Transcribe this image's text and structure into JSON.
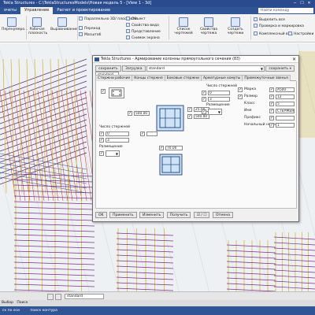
{
  "window": {
    "title": "Tekla Structures - C:\\TeklaStructuresModels\\Новая модель 5 - [View 1 - 3d]"
  },
  "ribbon": {
    "tabs": [
      "очеты",
      "Управление",
      "Расчет и проектирование"
    ],
    "active_tab": 1,
    "search_placeholder": "Найти команду",
    "buttons": {
      "renumber": "Перенумеро...",
      "work_area": "Рабочая плоскость",
      "align": "Выравнивание",
      "parallel": "Параллельно 3D/ плоскости",
      "move": "Переход",
      "scale": "Масштаб",
      "object": "Объект",
      "view_props": "Свойства вида",
      "presentation": "Представление",
      "screen_snapshot": "Снимок экрана",
      "drawings_list": "Список чертежей",
      "drawing_props": "Свойства чертежа",
      "create_drawings": "Создать чертежи",
      "select_all": "Выделить все",
      "check_and_mark": "Проверка и маркировка",
      "complex_view": "Комплексный вид",
      "settings": "Настройки"
    }
  },
  "dialog": {
    "title": "Tekla Structures - Армирование колонны прямоугольного сечения (83)",
    "save_label": "сохранить",
    "load_label": "Загрузка",
    "preset_value": "standard",
    "save_as_label": "сохранить к",
    "save_as_value": "standard",
    "tabs": [
      "Стержни рабочие",
      "Концы стержня",
      "Боковые стержни",
      "Арматурные хомуты",
      "Промежуточные звенья",
      "Верх",
      "Сжат"
    ],
    "active_tab": 5,
    "fields": {
      "cover_a": "500.00",
      "cover_b": "500.00",
      "cover_c": "25.00",
      "bars_count_label": "Число стержней",
      "bars_count_top": "0",
      "bars_count_top2": "3",
      "bars_count_left": "0",
      "bars_count_left2": "3",
      "placement_label": "Размещение",
      "placement_label2": "Размещение",
      "offset_value": "70.00",
      "mark_label": "Марка",
      "mark_value": "A500",
      "size_label": "Размер",
      "size_value": "12",
      "class_label": "Класс",
      "class_value": "5",
      "name_label": "Имя",
      "name_value": "СТЕРЖЕНЬ",
      "prefix_label": "Префикс",
      "prefix_value": "",
      "start_number_label": "Начальный номер",
      "start_number_value": "1"
    },
    "buttons": {
      "ok": "OK",
      "apply": "Применить",
      "modify": "Изменить",
      "get": "Получить",
      "toggle": "☑ / ☐",
      "cancel": "Отмена"
    }
  },
  "cmdbar": {
    "preset": "standard"
  },
  "statusbar": {
    "item1": "Выбор",
    "item2": "Поиск",
    "row2_left": "ск по оси",
    "row2_right": "поиск контура"
  }
}
